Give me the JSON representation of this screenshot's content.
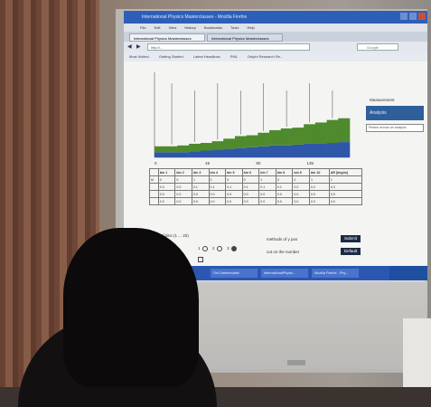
{
  "browser": {
    "title": "International Physics Masterclasses - Mozilla Firefox",
    "menu": [
      "File",
      "Edit",
      "View",
      "History",
      "Bookmarks",
      "Tools",
      "Help"
    ],
    "tabs": [
      "International Physics Masterclasses",
      "International Physics Masterclasses"
    ],
    "url": "http://...",
    "search_placeholder": "Google",
    "bookmarks": [
      "Most Visited",
      "Getting Started",
      "Latest Headlines",
      "PML",
      "Delphi Research Re..."
    ]
  },
  "sidebar": {
    "observation_label": "Measurement",
    "analysis_label": "Analysis",
    "select_value": "Please choose an analysis"
  },
  "table": {
    "headers": [
      "",
      "bin 1",
      "bin 2",
      "bin 3",
      "bin 4",
      "bin 5",
      "bin 6",
      "bin 7",
      "bin 8",
      "bin 9",
      "bin 10",
      "ΔR [deg/m]"
    ],
    "rows": [
      [
        "M",
        "0",
        "0",
        "1",
        "0",
        "0",
        "0",
        "1",
        "0",
        "0",
        "1",
        "1"
      ],
      [
        "",
        "0.0",
        "0.0",
        "0.1",
        "0.1",
        "0.1",
        "0.1",
        "0.1",
        "0.1",
        "0.2",
        "0.2",
        "0.3"
      ],
      [
        "",
        "0.0",
        "0.0",
        "0.0",
        "0.0",
        "0.0",
        "0.0",
        "0.0",
        "0.0",
        "0.0",
        "0.0",
        "0.0"
      ],
      [
        "",
        "0.0",
        "0.0",
        "0.0",
        "0.0",
        "0.0",
        "0.0",
        "0.0",
        "0.0",
        "0.0",
        "0.0",
        "0.0"
      ]
    ]
  },
  "form": {
    "bins_label": "number of bins (1 ... 20)",
    "distribution_label": "distribution",
    "options": [
      "1",
      "2",
      "3"
    ],
    "method_label": "methods of y pos",
    "cut_label": "cut on the number",
    "submit_label": "Submit",
    "default_label": "Default"
  },
  "taskbar": {
    "tasks": [
      "Ord Dateiendatei",
      "InternationalPhysic...",
      "Mozilla Firefox - Phy..."
    ]
  },
  "colors": {
    "green": "#4f8a2d",
    "blue": "#2f57a8",
    "analysis_blue": "#2f5f9a",
    "taskbar": "#2b56b2"
  },
  "chart_data": {
    "type": "area",
    "title": "",
    "xlabel": "",
    "ylabel": "",
    "xticks": [
      "0",
      "45",
      "90",
      "135"
    ],
    "ylim": [
      0,
      1
    ],
    "series": [
      {
        "values": [
          0.06,
          0.06,
          0.06,
          0.07,
          0.08,
          0.09,
          0.1,
          0.11,
          0.12,
          0.13,
          0.14,
          0.14,
          0.15,
          0.16,
          0.16,
          0.17,
          0.18
        ]
      },
      {
        "values": [
          0.07,
          0.07,
          0.08,
          0.09,
          0.09,
          0.1,
          0.12,
          0.14,
          0.14,
          0.16,
          0.18,
          0.2,
          0.2,
          0.23,
          0.25,
          0.27,
          0.28
        ]
      }
    ]
  }
}
